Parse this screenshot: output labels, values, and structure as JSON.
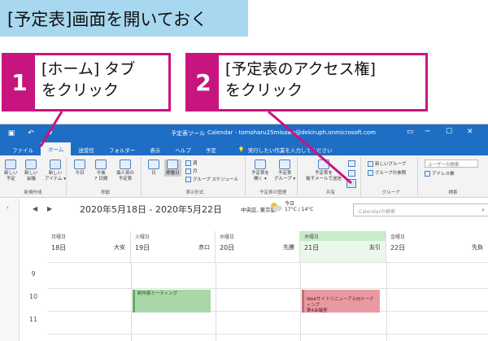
{
  "heading": "[予定表]画面を開いておく",
  "callouts": [
    {
      "num": "1",
      "text": "[ホーム] タブ\nをクリック"
    },
    {
      "num": "2",
      "text": "[予定表のアクセス権]\nをクリック"
    }
  ],
  "titlebar": {
    "tools_label": "予定表ツール",
    "title": "Calendar - tomoharu25misawa@dekiruph.onmicrosoft.com",
    "window_controls": [
      "▭",
      "─",
      "☐",
      "✕"
    ]
  },
  "tabs": {
    "file": "ファイル",
    "home": "ホーム",
    "send_receive": "送受信",
    "folder": "フォルダー",
    "view": "表示",
    "help": "ヘルプ",
    "schedule": "予定",
    "tell_me": "実行したい作業を入力してください"
  },
  "ribbon": {
    "groups": {
      "new": "新規作成",
      "move": "移動",
      "arrange": "表示形式",
      "manage": "予定表の管理",
      "share": "共有",
      "groups": "グループ",
      "find": "検索"
    },
    "buttons": {
      "new_appt": "新しい\n予定",
      "new_meeting": "新しい\n会議",
      "new_items": "新しい\nアイテム ▾",
      "today": "今日",
      "next7": "今後\n7 日間",
      "personal": "個人用の\n予定表",
      "day": "日",
      "workweek": "稼働日",
      "week": "週",
      "month": "月",
      "group_schedule": "グループ スケジュール",
      "open_calendar": "予定表を\n開く ▾",
      "calendar_groups": "予定表\nグループ ▾",
      "email_calendar": "予定表を\n電子メールで送信",
      "new_group": "新しいグループ",
      "browse_groups": "グループの参照",
      "search_people": "ユーザーの検索",
      "address_book": "アドレス帳"
    }
  },
  "calendar": {
    "range": "2020年5月18日 - 2020年5月22日",
    "location": "中央区, 東京都 ▾",
    "weather_day": "今日",
    "weather_temp": "17°C / 14°C",
    "search_placeholder": "Calendarの検索",
    "days": [
      {
        "weekday": "月曜日",
        "date": "18日",
        "rokuyo": "大安"
      },
      {
        "weekday": "火曜日",
        "date": "19日",
        "rokuyo": "赤口"
      },
      {
        "weekday": "水曜日",
        "date": "20日",
        "rokuyo": "先勝"
      },
      {
        "weekday": "木曜日",
        "date": "21日",
        "rokuyo": "友引"
      },
      {
        "weekday": "金曜日",
        "date": "22日",
        "rokuyo": "先負"
      }
    ],
    "hours": [
      "9",
      "10",
      "11"
    ],
    "events": [
      {
        "title": "制作部ミーティング",
        "day": "火曜日"
      },
      {
        "title": "WebサイトリニューアルPJミーティング\n第4会議室",
        "day": "木曜日"
      }
    ]
  },
  "colors": {
    "heading_bg": "#a8d8f0",
    "callout_accent": "#c8147e",
    "office_blue": "#1e6ec6",
    "today_bg": "#c8ecc8"
  }
}
